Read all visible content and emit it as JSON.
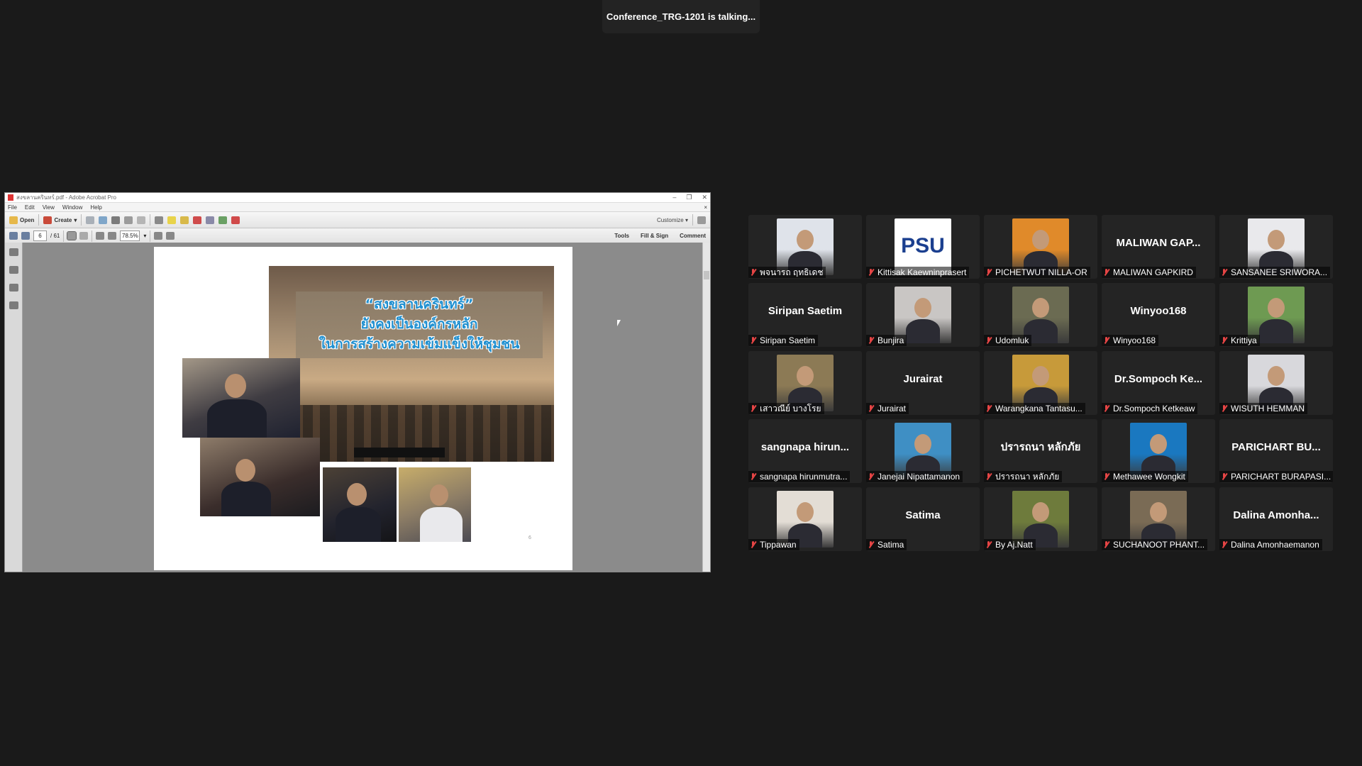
{
  "speaking_banner": "Conference_TRG-1201 is talking...",
  "acrobat": {
    "title": "สงขลานครินทร์.pdf - Adobe Acrobat Pro",
    "menu": [
      "File",
      "Edit",
      "View",
      "Window",
      "Help"
    ],
    "toolbar": {
      "open_label": "Open",
      "create_label": "Create",
      "customize_label": "Customize"
    },
    "nav": {
      "page_current": "6",
      "page_total": "/ 61",
      "zoom": "78.5%"
    },
    "panels": {
      "tools": "Tools",
      "fill_sign": "Fill & Sign",
      "comment": "Comment"
    },
    "slide": {
      "line1": "“สงขลานครินทร์”",
      "line2": "ยังคงเป็นองค์กรหลัก",
      "line3": "ในการสร้างความเข้มแข็งให้ชุมชน",
      "page_number": "6"
    }
  },
  "participants": [
    {
      "name": "พจนารถ ฤทธิเดช",
      "avatar": true,
      "color": "#dfe3ea"
    },
    {
      "name": "Kittisak Kaewninprasert",
      "avatar": true,
      "color": "#ffffff",
      "logo": "PSU"
    },
    {
      "name": "PICHETWUT NILLA-OR",
      "avatar": true,
      "color": "#e08a2a"
    },
    {
      "name": "MALIWAN GAPKIRD",
      "initial": "MALIWAN GAP..."
    },
    {
      "name": "SANSANEE SRIWORA...",
      "avatar": true,
      "color": "#e9e9ec"
    },
    {
      "name": "Siripan Saetim",
      "initial": "Siripan Saetim"
    },
    {
      "name": "Bunjira",
      "avatar": true,
      "color": "#c9c6c4"
    },
    {
      "name": "Udomluk",
      "avatar": true,
      "color": "#6b6b52"
    },
    {
      "name": "Winyoo168",
      "initial": "Winyoo168"
    },
    {
      "name": "Krittiya",
      "avatar": true,
      "color": "#6e9a52"
    },
    {
      "name": "เสาวณีย์ บางโรย",
      "avatar": true,
      "color": "#8c7a55"
    },
    {
      "name": "Jurairat",
      "initial": "Jurairat"
    },
    {
      "name": "Warangkana Tantasu...",
      "avatar": true,
      "color": "#c79a3a"
    },
    {
      "name": "Dr.Sompoch  Ketkeaw",
      "initial": "Dr.Sompoch   Ke..."
    },
    {
      "name": "WISUTH HEMMAN",
      "avatar": true,
      "color": "#d8d8dc"
    },
    {
      "name": "sangnapa hirunmutra...",
      "initial": "sangnapa  hirun..."
    },
    {
      "name": "Janejai Nipattamanon",
      "avatar": true,
      "color": "#3f8fc4"
    },
    {
      "name": "ปรารถนา หลักภัย",
      "initial": "ปรารถนา หลักภัย"
    },
    {
      "name": "Methawee Wongkit",
      "avatar": true,
      "color": "#1a78c0"
    },
    {
      "name": "PARICHART BURAPASI...",
      "initial": "PARICHART  BU..."
    },
    {
      "name": "Tippawan",
      "avatar": true,
      "color": "#e3ddd5"
    },
    {
      "name": "Satima",
      "initial": "Satima"
    },
    {
      "name": "By Aj.Natt",
      "avatar": true,
      "color": "#6e7b3c"
    },
    {
      "name": "SUCHANOOT PHANT...",
      "avatar": true,
      "color": "#7a6b55"
    },
    {
      "name": "Dalina Amonhaemanon",
      "initial": "Dalina  Amonha..."
    }
  ]
}
